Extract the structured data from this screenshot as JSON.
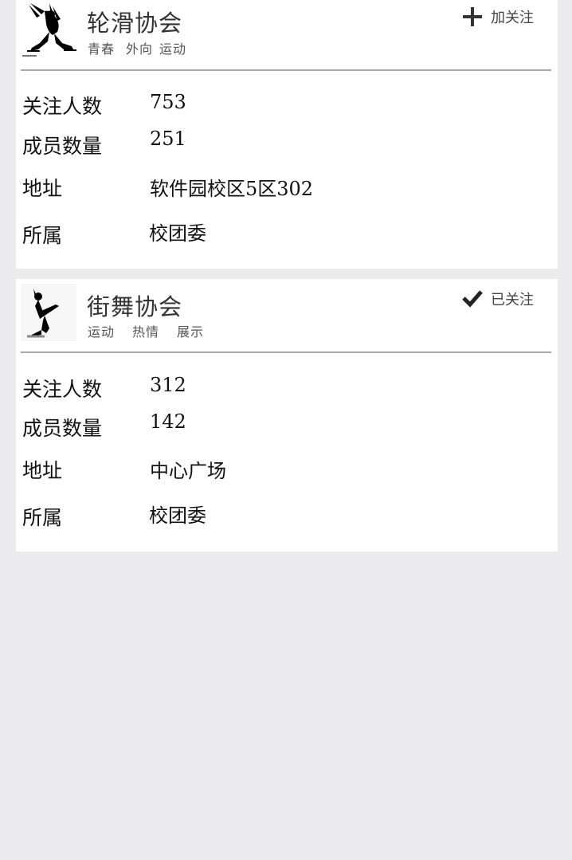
{
  "clubs": [
    {
      "avatar_icon": "skater-silhouette-icon",
      "name": "轮滑协会",
      "tags": [
        "青春",
        "外向",
        "运动"
      ],
      "follow_label": "加关注",
      "follow_icon": "plus-icon",
      "following": false,
      "fields": [
        {
          "label": "关注人数",
          "value": "753"
        },
        {
          "label": "成员数量",
          "value": "251"
        },
        {
          "label": "地址",
          "value": "软件园校区5区302"
        },
        {
          "label": "所属",
          "value": "校团委"
        }
      ]
    },
    {
      "avatar_icon": "dancer-silhouette-icon",
      "name": "街舞协会",
      "tags": [
        "运动",
        "热情",
        "展示"
      ],
      "follow_label": "已关注",
      "follow_icon": "check-icon",
      "following": true,
      "fields": [
        {
          "label": "关注人数",
          "value": "312"
        },
        {
          "label": "成员数量",
          "value": "142"
        },
        {
          "label": "地址",
          "value": "中心广场"
        },
        {
          "label": "所属",
          "value": "校团委"
        }
      ]
    }
  ]
}
